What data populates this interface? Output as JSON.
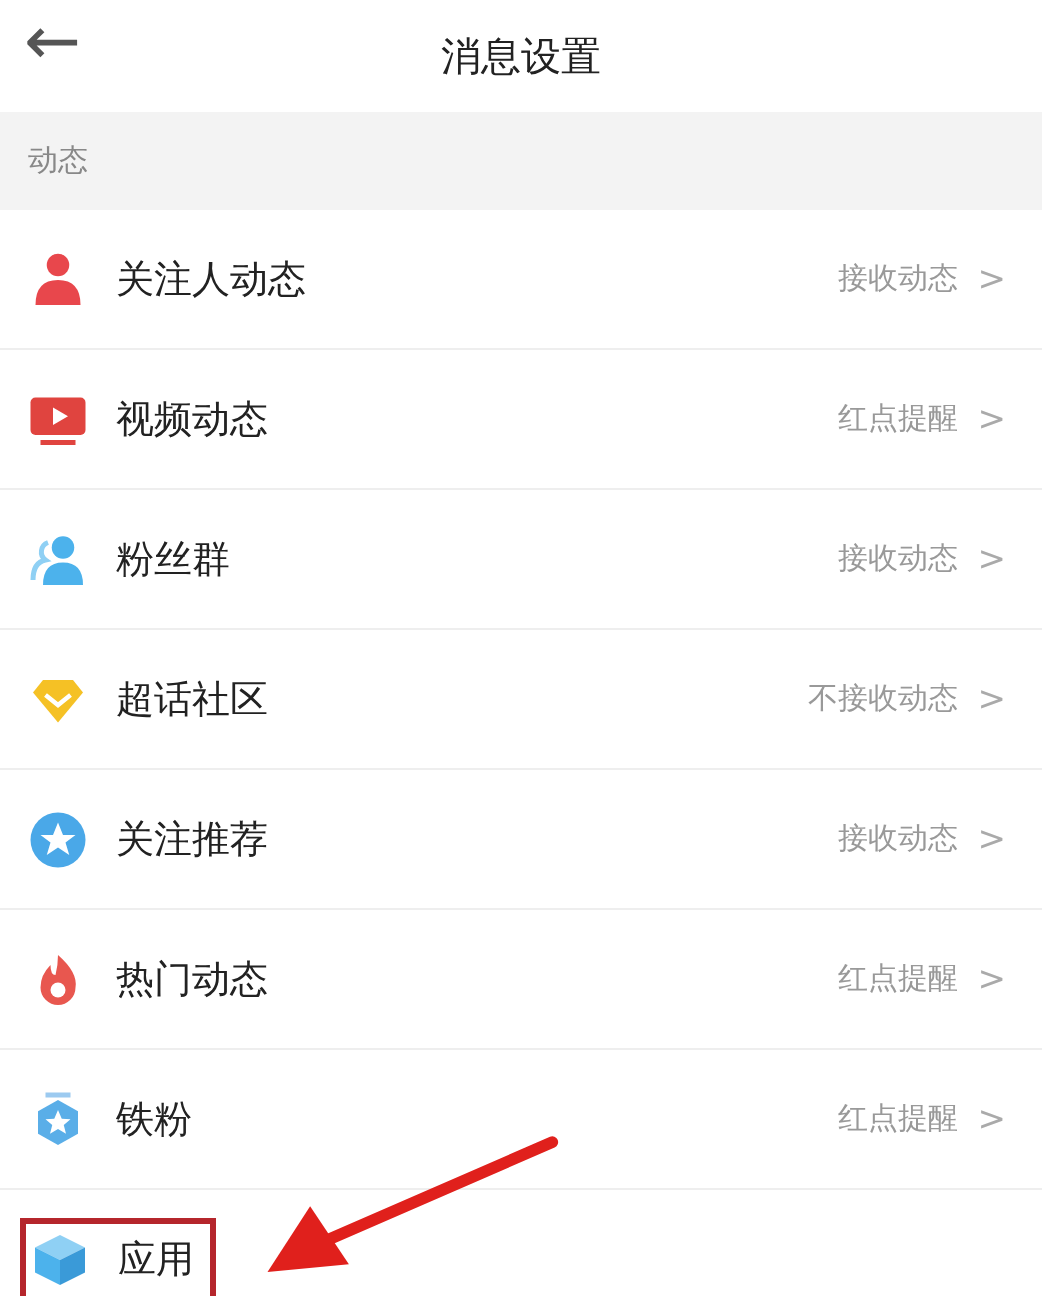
{
  "header": {
    "back": "←",
    "title": "消息设置"
  },
  "section": {
    "title": "动态"
  },
  "items": [
    {
      "label": "关注人动态",
      "value": "接收动态",
      "chevron": ">",
      "highlighted": false
    },
    {
      "label": "视频动态",
      "value": "红点提醒",
      "chevron": ">",
      "highlighted": false
    },
    {
      "label": "粉丝群",
      "value": "接收动态",
      "chevron": ">",
      "highlighted": false
    },
    {
      "label": "超话社区",
      "value": "不接收动态",
      "chevron": ">",
      "highlighted": false
    },
    {
      "label": "关注推荐",
      "value": "接收动态",
      "chevron": ">",
      "highlighted": false
    },
    {
      "label": "热门动态",
      "value": "红点提醒",
      "chevron": ">",
      "highlighted": false
    },
    {
      "label": "铁粉",
      "value": "红点提醒",
      "chevron": ">",
      "highlighted": false
    },
    {
      "label": "应用",
      "highlighted": true
    }
  ]
}
